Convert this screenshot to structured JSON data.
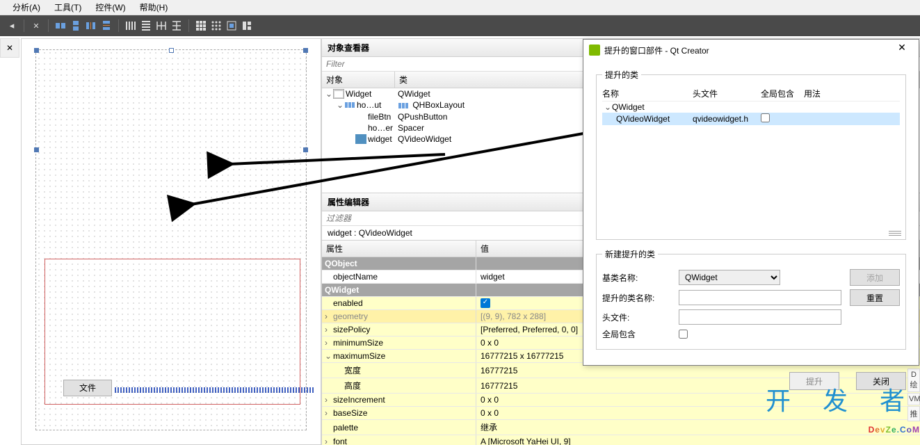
{
  "menubar": [
    "分析(A)",
    "工具(T)",
    "控件(W)",
    "帮助(H)"
  ],
  "designer": {
    "file_button": "文件"
  },
  "object_inspector": {
    "title": "对象查看器",
    "filter_placeholder": "Filter",
    "headers": [
      "对象",
      "类"
    ],
    "rows": [
      {
        "indent": 0,
        "exp": "v",
        "name": "Widget",
        "cls": "QWidget",
        "icon": "form"
      },
      {
        "indent": 1,
        "exp": "v",
        "name": "ho…ut",
        "cls": "QHBoxLayout",
        "icon": "hbox"
      },
      {
        "indent": 2,
        "exp": "",
        "name": "fileBtn",
        "cls": "QPushButton",
        "icon": ""
      },
      {
        "indent": 2,
        "exp": "",
        "name": "ho…er",
        "cls": "Spacer",
        "icon": ""
      },
      {
        "indent": 2,
        "exp": "",
        "name": "widget",
        "cls": "QVideoWidget",
        "icon": "q",
        "sel": true
      }
    ]
  },
  "property_editor": {
    "title": "属性编辑器",
    "filter_placeholder": "过滤器",
    "context": "widget : QVideoWidget",
    "headers": [
      "属性",
      "值"
    ],
    "rows": [
      {
        "type": "group",
        "k": "QObject"
      },
      {
        "k": "objectName",
        "v": "widget",
        "alt": false
      },
      {
        "type": "group",
        "k": "QWidget"
      },
      {
        "k": "enabled",
        "v": "[check]",
        "alt": true
      },
      {
        "k": "geometry",
        "v": "[(9, 9), 782 x 288]",
        "alt": true,
        "exp": ">",
        "sel": true,
        "dim": true
      },
      {
        "k": "sizePolicy",
        "v": "[Preferred, Preferred, 0, 0]",
        "alt": true,
        "exp": ">"
      },
      {
        "k": "minimumSize",
        "v": "0 x 0",
        "alt": true,
        "exp": ">"
      },
      {
        "k": "maximumSize",
        "v": "16777215 x 16777215",
        "alt": true,
        "exp": "v"
      },
      {
        "k": "宽度",
        "v": "16777215",
        "alt": true,
        "sub": true
      },
      {
        "k": "高度",
        "v": "16777215",
        "alt": true,
        "sub": true
      },
      {
        "k": "sizeIncrement",
        "v": "0 x 0",
        "alt": true,
        "exp": ">"
      },
      {
        "k": "baseSize",
        "v": "0 x 0",
        "alt": true,
        "exp": ">"
      },
      {
        "k": "palette",
        "v": "继承",
        "alt": true
      },
      {
        "k": "font",
        "v": "A  [Microsoft YaHei UI, 9]",
        "alt": true,
        "exp": ">"
      }
    ]
  },
  "dialog": {
    "title": "提升的窗口部件 - Qt Creator",
    "group1_title": "提升的类",
    "class_headers": [
      "名称",
      "头文件",
      "全局包含",
      "用法"
    ],
    "class_rows": [
      {
        "indent": 0,
        "name": "QWidget",
        "header": "",
        "global": "",
        "exp": "v"
      },
      {
        "indent": 1,
        "name": "QVideoWidget",
        "header": "qvideowidget.h",
        "global": false,
        "sel": true
      }
    ],
    "group2_title": "新建提升的类",
    "base_label": "基类名称:",
    "base_value": "QWidget",
    "promoted_label": "提升的类名称:",
    "header_label": "头文件:",
    "global_label": "全局包含",
    "add_button": "添加",
    "reset_button": "重置",
    "promote_button": "提升",
    "close_button": "关闭"
  },
  "right_tabs": [
    "D绘",
    "VML",
    "推"
  ],
  "watermark": {
    "line1": "开 发 者",
    "line2_chars": [
      "D",
      "e",
      "v",
      "Z",
      "e",
      ".",
      "C",
      "o",
      "M"
    ]
  }
}
